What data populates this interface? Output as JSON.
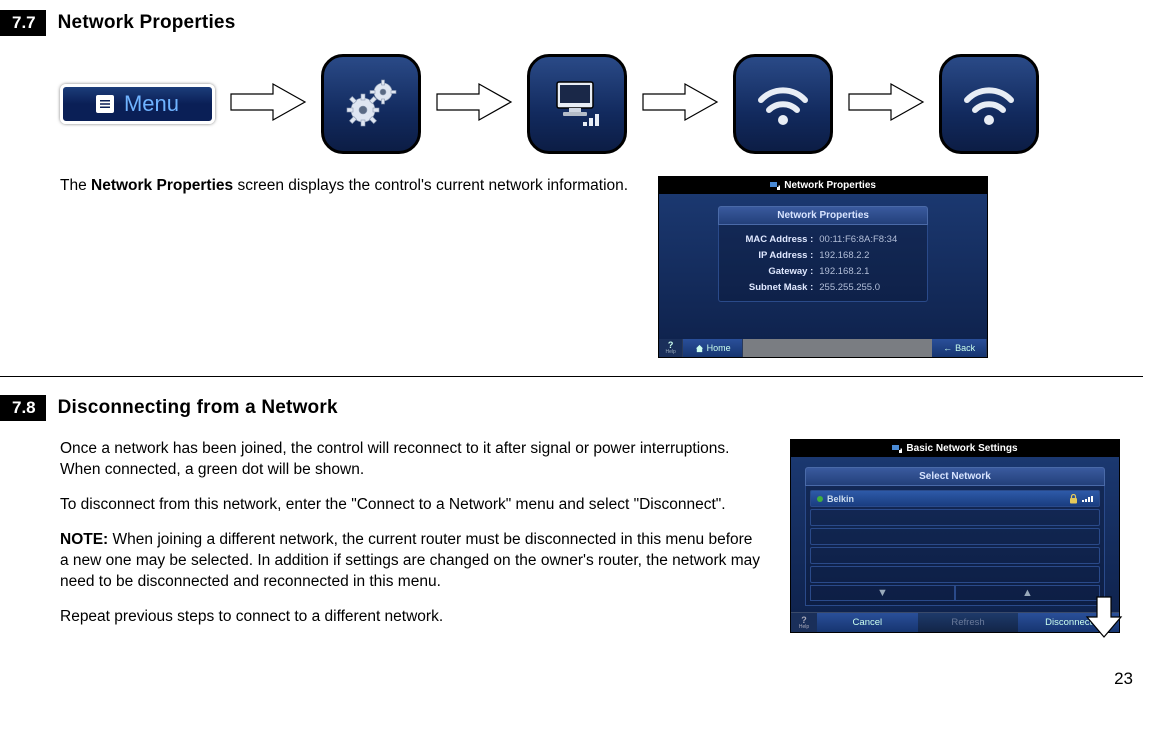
{
  "section77": {
    "num": "7.7",
    "title": "Network Properties",
    "menu_label": "Menu",
    "desc_prefix": "The ",
    "desc_bold": "Network Properties",
    "desc_suffix": " screen displays the control's current network information."
  },
  "props_screen": {
    "title": "Network Properties",
    "panel_title": "Network Properties",
    "rows": [
      {
        "label": "MAC Address :",
        "value": "00:11:F6:8A:F8:34"
      },
      {
        "label": "IP Address :",
        "value": "192.168.2.2"
      },
      {
        "label": "Gateway :",
        "value": "192.168.2.1"
      },
      {
        "label": "Subnet Mask :",
        "value": "255.255.255.0"
      }
    ],
    "help": "?",
    "help_sub": "Help",
    "home": "Home",
    "back": "Back"
  },
  "section78": {
    "num": "7.8",
    "title": "Disconnecting from a Network",
    "p1": "Once a network has been joined, the control will reconnect to it after signal or power interruptions. When connected, a green dot will be shown.",
    "p2": "To disconnect from this network, enter the \"Connect to a Network\" menu and select \"Disconnect\".",
    "p3_bold": "NOTE:",
    "p3_rest": " When joining a different network, the current router must be disconnected in this menu before a new one may be selected. In addition if settings are changed on the owner's router, the network may need to be disconnected and reconnected in this menu.",
    "p4": "Repeat previous steps to connect to a different network."
  },
  "net_screen": {
    "title": "Basic Network Settings",
    "panel_title": "Select Network",
    "selected_network": "Belkin",
    "help": "?",
    "help_sub": "Help",
    "cancel": "Cancel",
    "refresh": "Refresh",
    "disconnect": "Disconnect"
  },
  "page_number": "23"
}
